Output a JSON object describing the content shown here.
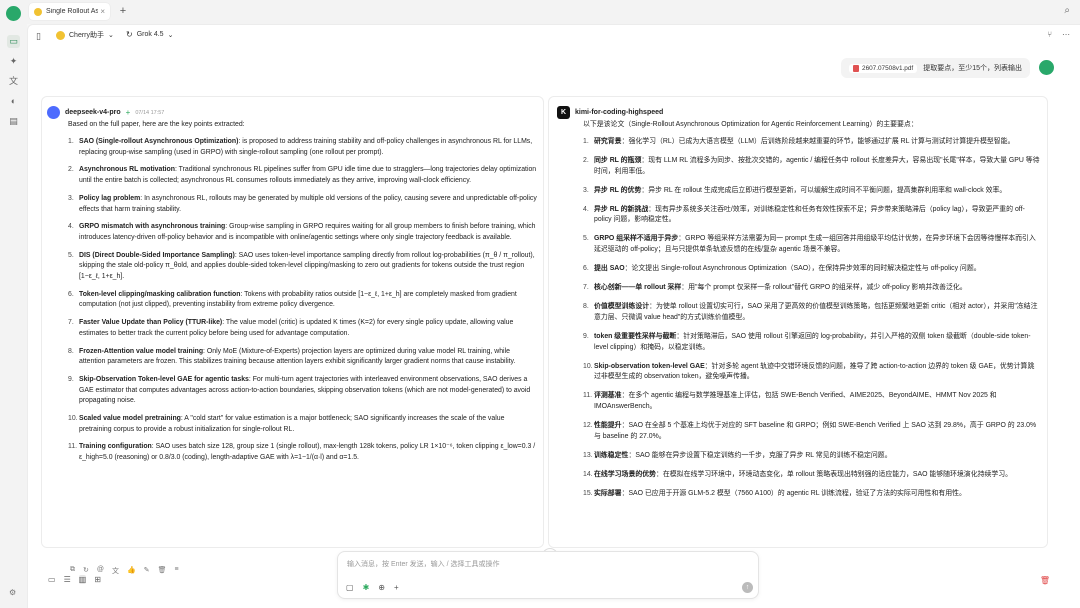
{
  "tabs": [
    {
      "label": "Single Rollout Asy"
    }
  ],
  "header": {
    "model1": "Cherry助手",
    "model2": "Grok 4.5"
  },
  "user_message": {
    "file": "2607.07508v1.pdf",
    "text": "提取要点，至少15个，列表输出"
  },
  "left": {
    "model": "deepseek-v4-pro",
    "time": "07/14 17:57",
    "intro": "Based on the full paper, here are the key points extracted:",
    "points": [
      {
        "n": "1.",
        "title": "SAO (Single-rollout Asynchronous Optimization)",
        "text": ": is proposed to address training stability and off-policy challenges in asynchronous RL for LLMs, replacing group-wise sampling (used in GRPO) with single-rollout sampling (one rollout per prompt)."
      },
      {
        "n": "2.",
        "title": "Asynchronous RL motivation",
        "text": ": Traditional synchronous RL pipelines suffer from GPU idle time due to stragglers—long trajectories delay optimization until the entire batch is collected; asynchronous RL consumes rollouts immediately as they arrive, improving wall-clock efficiency."
      },
      {
        "n": "3.",
        "title": "Policy lag problem",
        "text": ": In asynchronous RL, rollouts may be generated by multiple old versions of the policy, causing severe and unpredictable off-policy effects that harm training stability."
      },
      {
        "n": "4.",
        "title": "GRPO mismatch with asynchronous training",
        "text": ": Group-wise sampling in GRPO requires waiting for all group members to finish before training, which introduces latency-driven off-policy behavior and is incompatible with online/agentic settings where only single trajectory feedback is available."
      },
      {
        "n": "5.",
        "title": "DIS (Direct Double-Sided Importance Sampling)",
        "text": ": SAO uses token-level importance sampling directly from rollout log-probabilities (π_θ / π_rollout), skipping the stale old-policy π_θold, and applies double-sided token-level clipping/masking to zero out gradients for tokens outside the trust region [1−ε_ℓ, 1+ε_h]."
      },
      {
        "n": "6.",
        "title": "Token-level clipping/masking calibration function",
        "text": ": Tokens with probability ratios outside [1−ε_ℓ, 1+ε_h] are completely masked from gradient computation (not just clipped), preventing instability from extreme policy divergence."
      },
      {
        "n": "7.",
        "title": "Faster Value Update than Policy (TTUR-like)",
        "text": ": The value model (critic) is updated K times (K=2) for every single policy update, allowing value estimates to better track the current policy before being used for advantage computation."
      },
      {
        "n": "8.",
        "title": "Frozen-Attention value model training",
        "text": ": Only MoE (Mixture-of-Experts) projection layers are optimized during value model RL training, while attention parameters are frozen. This stabilizes training because attention layers exhibit significantly larger gradient norms that cause instability."
      },
      {
        "n": "9.",
        "title": "Skip-Observation Token-level GAE for agentic tasks",
        "text": ": For multi-turn agent trajectories with interleaved environment observations, SAO derives a GAE estimator that computes advantages across action-to-action boundaries, skipping observation tokens (which are not model-generated) to avoid propagating noise."
      },
      {
        "n": "10.",
        "title": "Scaled value model pretraining",
        "text": ": A \"cold start\" for value estimation is a major bottleneck; SAO significantly increases the scale of the value pretraining corpus to provide a robust initialization for single-rollout RL."
      },
      {
        "n": "11.",
        "title": "Training configuration",
        "text": ": SAO uses batch size 128, group size 1 (single rollout), max-length 128k tokens, policy LR 1×10⁻⁶, token clipping ε_low=0.3 / ε_high=5.0 (reasoning) or 0.8/3.0 (coding), length-adaptive GAE with λ=1−1/(α·l) and α=1.5."
      }
    ]
  },
  "right": {
    "model": "kimi-for-coding-highspeed",
    "intro": "以下是该论文（Single-Rollout Asynchronous Optimization for Agentic Reinforcement Learning）的主要要点：",
    "points": [
      {
        "n": "1.",
        "title": "研究背景",
        "text": "：强化学习（RL）已成为大语言模型（LLM）后训练阶段越来越重要的环节，能够通过扩展 RL 计算与测试时计算提升模型智能。"
      },
      {
        "n": "2.",
        "title": "同步 RL 的瓶颈",
        "text": "：现有 LLM RL 流程多为同步、按批次交错的，agentic / 编程任务中 rollout 长度差异大，容易出现\"长尾\"样本，导致大量 GPU 等待时间，利用率低。"
      },
      {
        "n": "3.",
        "title": "异步 RL 的优势",
        "text": "：异步 RL 在 rollout 生成完成后立即进行模型更新，可以缓解生成时间不平衡问题，提高集群利用率和 wall-clock 效率。"
      },
      {
        "n": "4.",
        "title": "异步 RL 的新挑战",
        "text": "：现有异步系统多关注吞吐/效率，对训练稳定性和任务有效性探索不足；异步带来策略滞后（policy lag），导致更严重的 off-policy 问题，影响稳定性。"
      },
      {
        "n": "5.",
        "title": "GRPO 组采样不适用于异步",
        "text": "：GRPO 等组采样方法需要为同一 prompt 生成一组回答并用组级平均估计优势，在异步环境下会因等待慢样本而引入延迟驱动的 off-policy；且与只提供单条轨迹反馈的在线/复杂 agentic 场景不兼容。"
      },
      {
        "n": "6.",
        "title": "提出 SAO",
        "text": "：论文提出 Single-rollout Asynchronous Optimization（SAO），在保持异步效率的同时解决稳定性与 off-policy 问题。"
      },
      {
        "n": "7.",
        "title": "核心创新——单 rollout 采样",
        "text": "：用\"每个 prompt 仅采样一条 rollout\"替代 GRPO 的组采样，减少 off-policy 影响并改善泛化。"
      },
      {
        "n": "8.",
        "title": "价值模型训练设计",
        "text": "：为使单 rollout 设置切实可行，SAO 采用了更高效的价值模型训练策略，包括更频繁地更新 critic（相对 actor），并采用\"冻结注意力层、只微调 value head\"的方式训练价值模型。"
      },
      {
        "n": "9.",
        "title": "token 级重要性采样与截断",
        "text": "：针对策略滞后，SAO 使用 rollout 引擎返回的 log-probability，并引入严格的双侧 token 级截断（double-side token-level clipping）和掩码，以稳定训练。"
      },
      {
        "n": "10.",
        "title": "Skip-observation token-level GAE",
        "text": "：针对多轮 agent 轨迹中交错环境反馈的问题，推导了跨 action-to-action 边界的 token 级 GAE，优势计算跳过非模型生成的 observation token，避免噪声传播。"
      },
      {
        "n": "11.",
        "title": "评测基准",
        "text": "：在多个 agentic 编程与数学推理基准上评估，包括 SWE-Bench Verified、AIME2025、BeyondAIME、HMMT Nov 2025 和 IMOAnswerBench。"
      },
      {
        "n": "12.",
        "title": "性能提升",
        "text": "：SAO 在全部 5 个基准上均优于对应的 SFT baseline 和 GRPO；例如 SWE-Bench Verified 上 SAO 达到 29.8%，高于 GRPO 的 23.0% 与 baseline 的 27.0%。"
      },
      {
        "n": "13.",
        "title": "训练稳定性",
        "text": "：SAO 能够在异步设置下稳定训练约一千步，克服了异步 RL 常见的训练不稳定问题。"
      },
      {
        "n": "14.",
        "title": "在线学习场景的优势",
        "text": "：在模拟在线学习环境中，环境动态变化，单 rollout 策略表现出特别强的适应能力，SAO 能够随环境演化持续学习。"
      },
      {
        "n": "15.",
        "title": "实际部署",
        "text": "：SAO 已应用于开源 GLM-5.2 模型（7560 A100）的 agentic RL 训练流程，验证了方法的实际可用性和有用性。"
      }
    ]
  },
  "composer": {
    "placeholder": "输入消息，按 Enter 发送，输入 / 选择工具或操作"
  }
}
